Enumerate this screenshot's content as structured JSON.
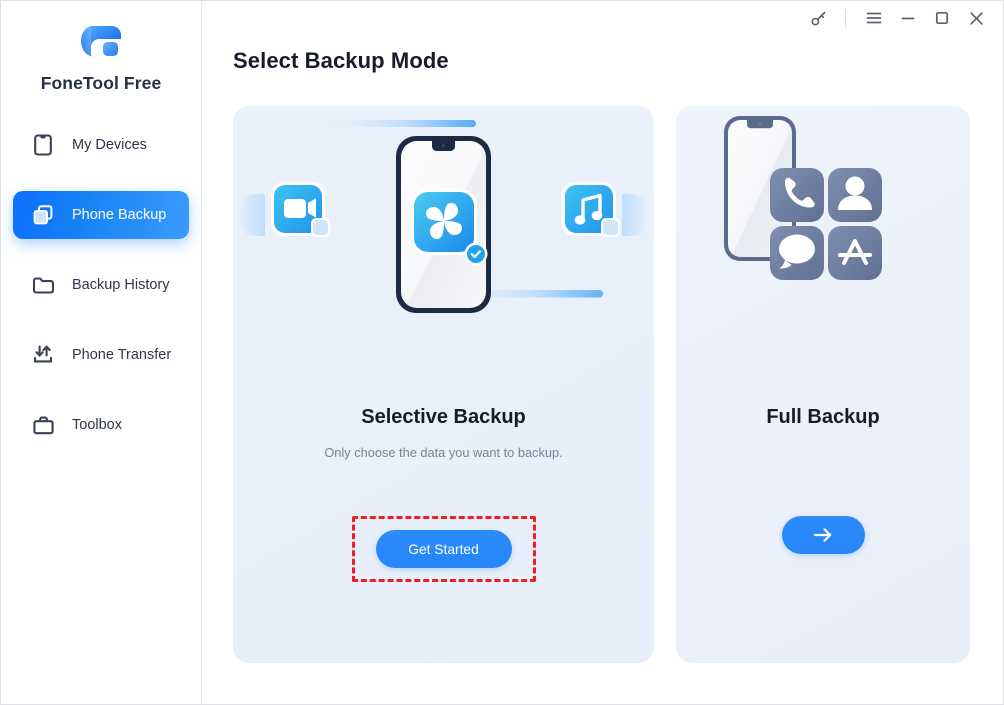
{
  "app": {
    "brand_name": "FoneTool Free",
    "logo_icon": "fonetool-logo-icon"
  },
  "titlebar": {
    "buttons": [
      {
        "name": "key-icon",
        "label": "Activate"
      },
      {
        "name": "hamburger-icon",
        "label": "Menu"
      },
      {
        "name": "minimize-icon",
        "label": "Minimize"
      },
      {
        "name": "maximize-icon",
        "label": "Maximize"
      },
      {
        "name": "close-icon",
        "label": "Close"
      }
    ]
  },
  "sidebar": {
    "items": [
      {
        "label": "My Devices",
        "icon": "phone-icon",
        "active": false
      },
      {
        "label": "Phone Backup",
        "icon": "copy-layers-icon",
        "active": true
      },
      {
        "label": "Backup History",
        "icon": "folder-icon",
        "active": false
      },
      {
        "label": "Phone Transfer",
        "icon": "transfer-arrows-icon",
        "active": false
      },
      {
        "label": "Toolbox",
        "icon": "briefcase-icon",
        "active": false
      }
    ]
  },
  "main": {
    "page_title": "Select Backup Mode",
    "cards": [
      {
        "id": "selective-backup",
        "heading": "Selective Backup",
        "subtitle": "Only choose the data you want to backup.",
        "cta_label": "Get Started",
        "highlighted": true,
        "illustration_icons": [
          "video-icon",
          "photos-pinwheel-icon",
          "music-note-icon",
          "check-badge-icon"
        ]
      },
      {
        "id": "full-backup",
        "heading": "Full Backup",
        "subtitle": "",
        "cta_label": "→",
        "highlighted": false,
        "illustration_icons": [
          "phone-call-icon",
          "contacts-icon",
          "messages-icon",
          "app-store-icon"
        ]
      }
    ]
  },
  "colors": {
    "accent_blue": "#2586fa",
    "active_nav_start": "#0d6efd",
    "active_nav_end": "#3a9bfb",
    "highlight_red": "#f21e1e",
    "card_bg": "#eaf1fb",
    "text_dark": "#181c2a",
    "text_muted": "#7b8294",
    "illustration_muted": "#6b7a99"
  }
}
